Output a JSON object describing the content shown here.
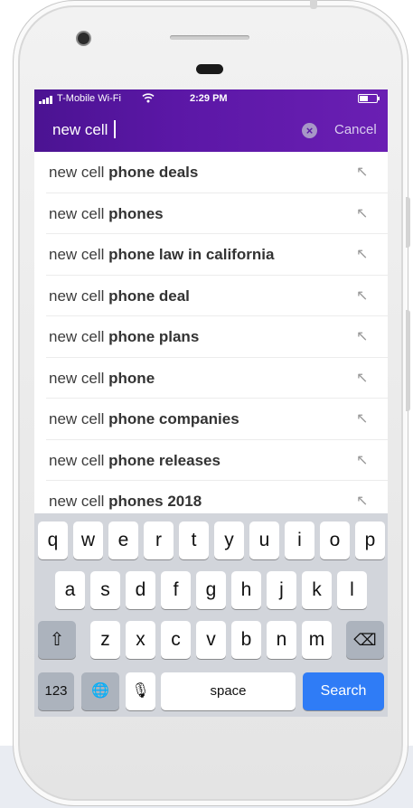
{
  "status_bar": {
    "carrier": "T-Mobile Wi-Fi",
    "time": "2:29 PM"
  },
  "search": {
    "value": "new cell",
    "cancel_label": "Cancel"
  },
  "suggestions": [
    {
      "prefix": "new cell",
      "completion": "phone deals"
    },
    {
      "prefix": "new cell",
      "completion": "phones"
    },
    {
      "prefix": "new cell",
      "completion": "phone law in california"
    },
    {
      "prefix": "new cell",
      "completion": "phone deal"
    },
    {
      "prefix": "new cell",
      "completion": "phone plans"
    },
    {
      "prefix": "new cell",
      "completion": "phone"
    },
    {
      "prefix": "new cell",
      "completion": "phone companies"
    },
    {
      "prefix": "new cell",
      "completion": "phone releases"
    },
    {
      "prefix": "new cell",
      "completion": "phones 2018"
    }
  ],
  "keyboard": {
    "row1": [
      "q",
      "w",
      "e",
      "r",
      "t",
      "y",
      "u",
      "i",
      "o",
      "p"
    ],
    "row2": [
      "a",
      "s",
      "d",
      "f",
      "g",
      "h",
      "j",
      "k",
      "l"
    ],
    "row3": [
      "z",
      "x",
      "c",
      "v",
      "b",
      "n",
      "m"
    ],
    "numbers_label": "123",
    "space_label": "space",
    "search_label": "Search"
  },
  "icons": {
    "fill_arrow": "↖",
    "clear": "×",
    "shift": "⇧",
    "backspace": "⌫",
    "globe": "🌐",
    "mic": "🎙"
  },
  "colors": {
    "header_start": "#4b1392",
    "header_end": "#6a1fb3",
    "search_key": "#2f7cf6",
    "keyboard_bg": "#d2d5db"
  }
}
